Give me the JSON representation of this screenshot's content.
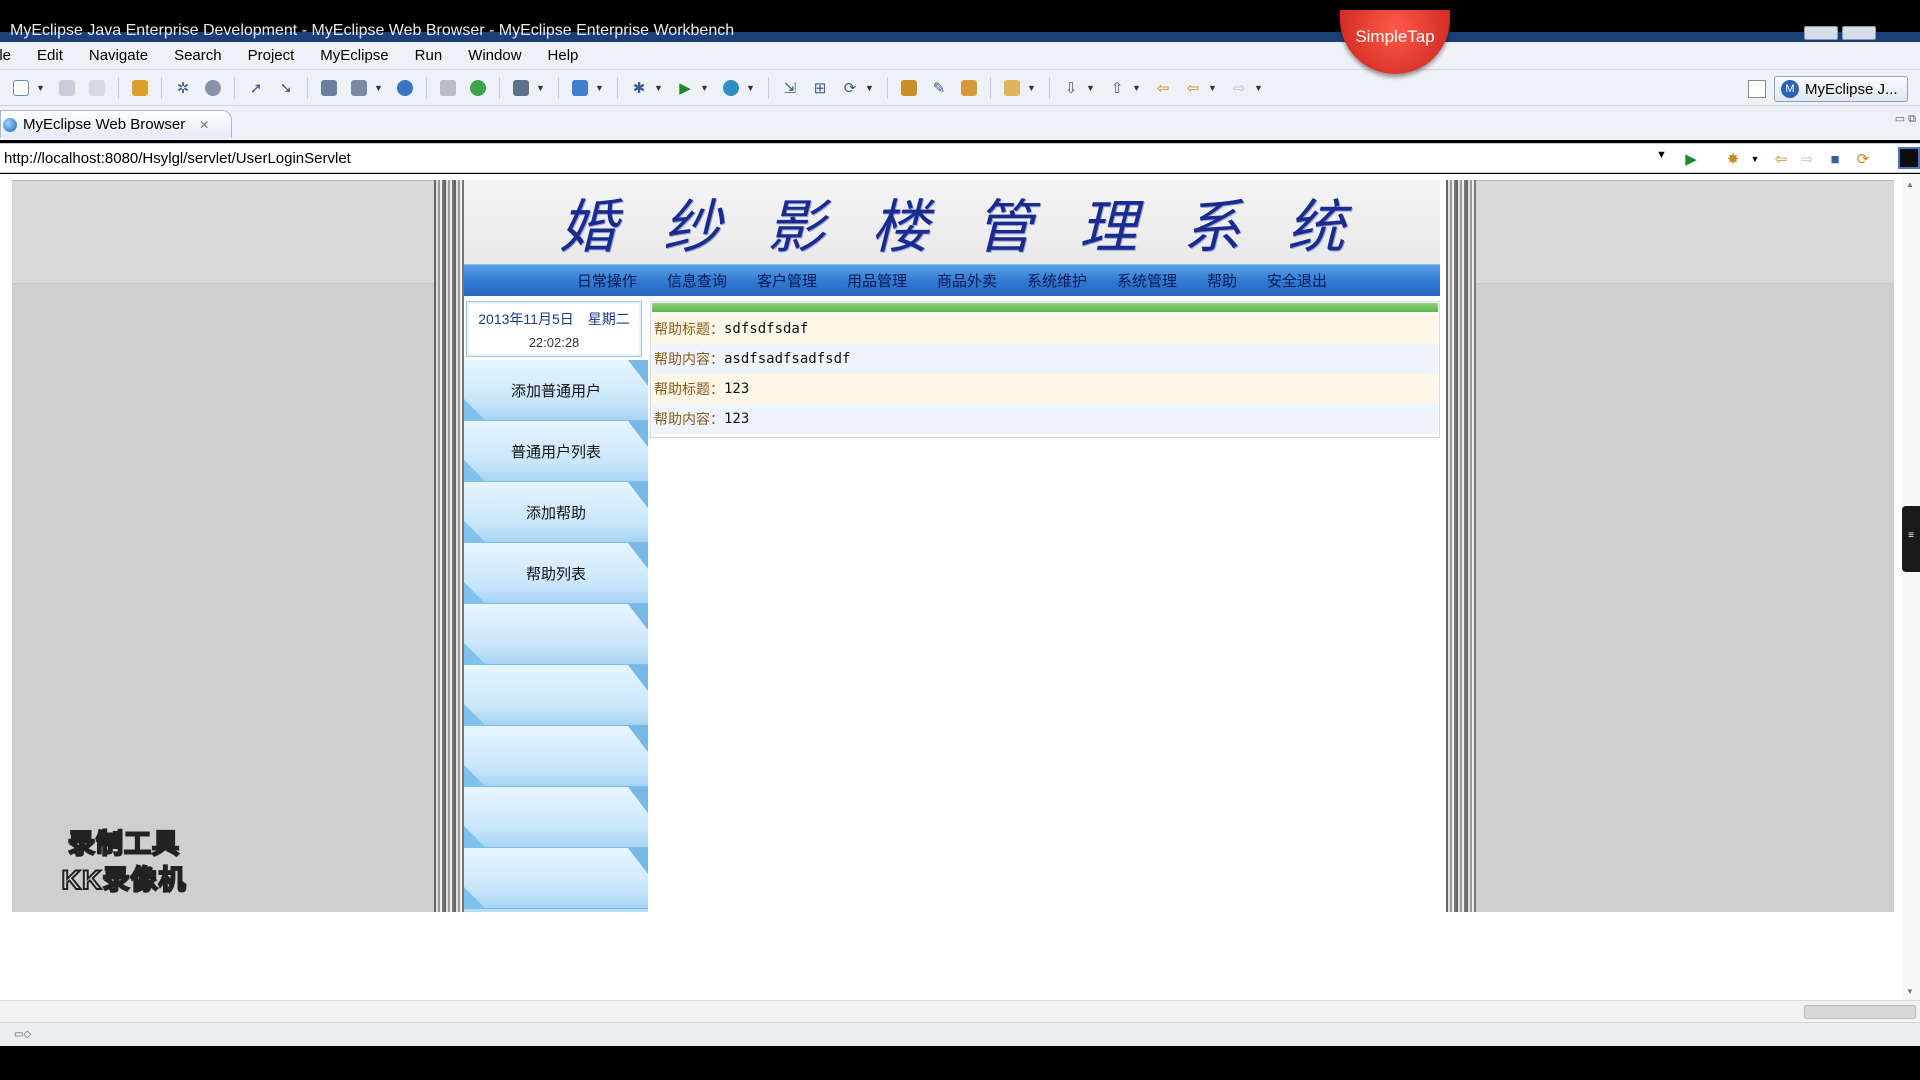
{
  "window": {
    "title": "MyEclipse Java Enterprise Development - MyEclipse Web Browser - MyEclipse Enterprise Workbench",
    "overlay_badge": "SimpleTap"
  },
  "menubar": [
    "ile",
    "Edit",
    "Navigate",
    "Search",
    "Project",
    "MyEclipse",
    "Run",
    "Window",
    "Help"
  ],
  "perspective": {
    "label": "MyEclipse J...",
    "icon": "myeclipse-logo-icon"
  },
  "editor_tab": {
    "label": "MyEclipse Web Browser",
    "close": "✕"
  },
  "browser": {
    "url": "http://localhost:8080/Hsylgl/servlet/UserLoginServlet"
  },
  "site": {
    "title": "婚纱影楼管理系统",
    "nav": [
      "日常操作",
      "信息查询",
      "客户管理",
      "用品管理",
      "商品外卖",
      "系统维护",
      "系统管理",
      "帮助",
      "安全退出"
    ],
    "date": "2013年11月5日　星期二",
    "time": "22:02:28",
    "sidebar": [
      "添加普通用户",
      "普通用户列表",
      "添加帮助",
      "帮助列表",
      "",
      "",
      "",
      "",
      ""
    ],
    "help_rows": [
      {
        "label": "帮助标题：",
        "value": "sdfsdfsdaf",
        "bg": "#fdf6e9"
      },
      {
        "label": "帮助内容：",
        "value": "asdfsadfsadfsdf",
        "bg": "#eef4fb"
      },
      {
        "label": "帮助标题：",
        "value": "123",
        "bg": "#fdf6e9"
      },
      {
        "label": "帮助内容：",
        "value": "123",
        "bg": "#eef4fb"
      }
    ]
  },
  "watermark": {
    "line1": "录制工具",
    "line2": "KK录像机"
  },
  "colors": {
    "nav_blue": "#2f78d0",
    "title_navy": "#1a2b8f",
    "green_bar": "#5fb54c",
    "sidebar_blue": "#b9ddf6"
  }
}
